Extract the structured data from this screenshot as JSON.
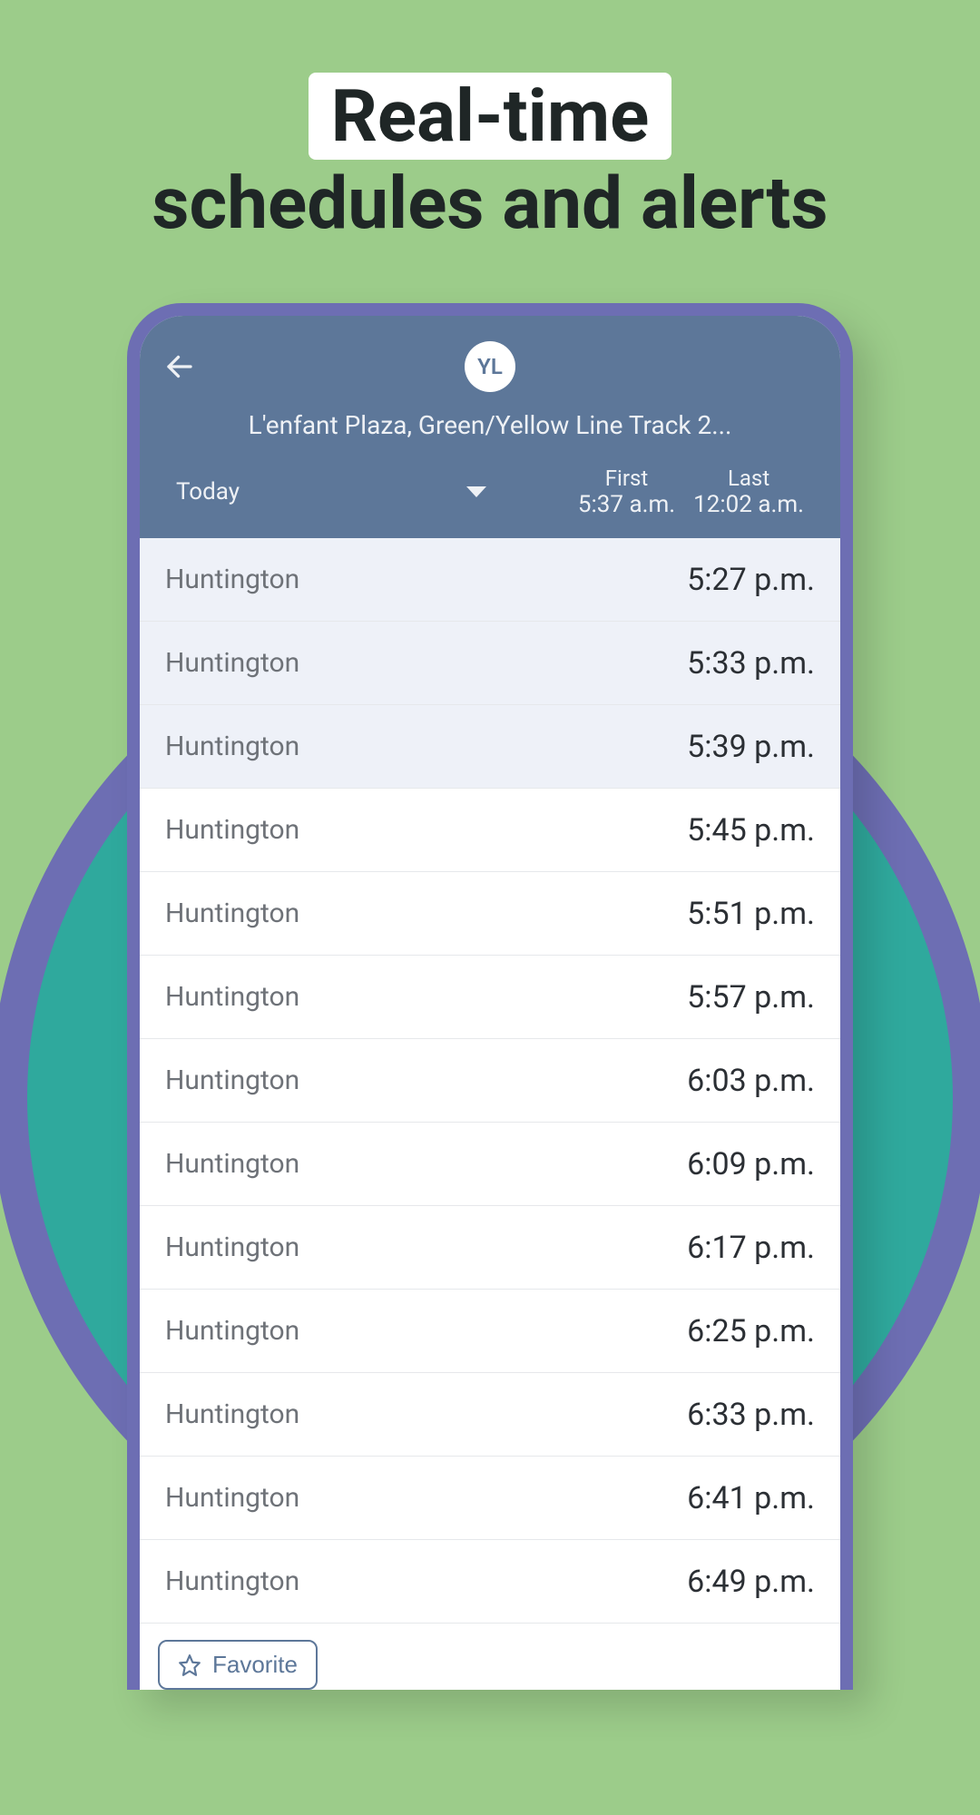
{
  "headline": {
    "line1": "Real-time",
    "line2": "schedules and alerts"
  },
  "header": {
    "line_badge": "YL",
    "station_title": "L'enfant Plaza, Green/Yellow Line Track 2...",
    "date_label": "Today",
    "first_label": "First",
    "first_time": "5:37 a.m.",
    "last_label": "Last",
    "last_time": "12:02 a.m."
  },
  "schedule": [
    {
      "destination": "Huntington",
      "time": "5:27 p.m.",
      "highlight": true
    },
    {
      "destination": "Huntington",
      "time": "5:33 p.m.",
      "highlight": true
    },
    {
      "destination": "Huntington",
      "time": "5:39 p.m.",
      "highlight": true
    },
    {
      "destination": "Huntington",
      "time": "5:45 p.m.",
      "highlight": false
    },
    {
      "destination": "Huntington",
      "time": "5:51 p.m.",
      "highlight": false
    },
    {
      "destination": "Huntington",
      "time": "5:57 p.m.",
      "highlight": false
    },
    {
      "destination": "Huntington",
      "time": "6:03 p.m.",
      "highlight": false
    },
    {
      "destination": "Huntington",
      "time": "6:09 p.m.",
      "highlight": false
    },
    {
      "destination": "Huntington",
      "time": "6:17 p.m.",
      "highlight": false
    },
    {
      "destination": "Huntington",
      "time": "6:25 p.m.",
      "highlight": false
    },
    {
      "destination": "Huntington",
      "time": "6:33 p.m.",
      "highlight": false
    },
    {
      "destination": "Huntington",
      "time": "6:41 p.m.",
      "highlight": false
    },
    {
      "destination": "Huntington",
      "time": "6:49 p.m.",
      "highlight": false
    }
  ],
  "favorite_label": "Favorite"
}
